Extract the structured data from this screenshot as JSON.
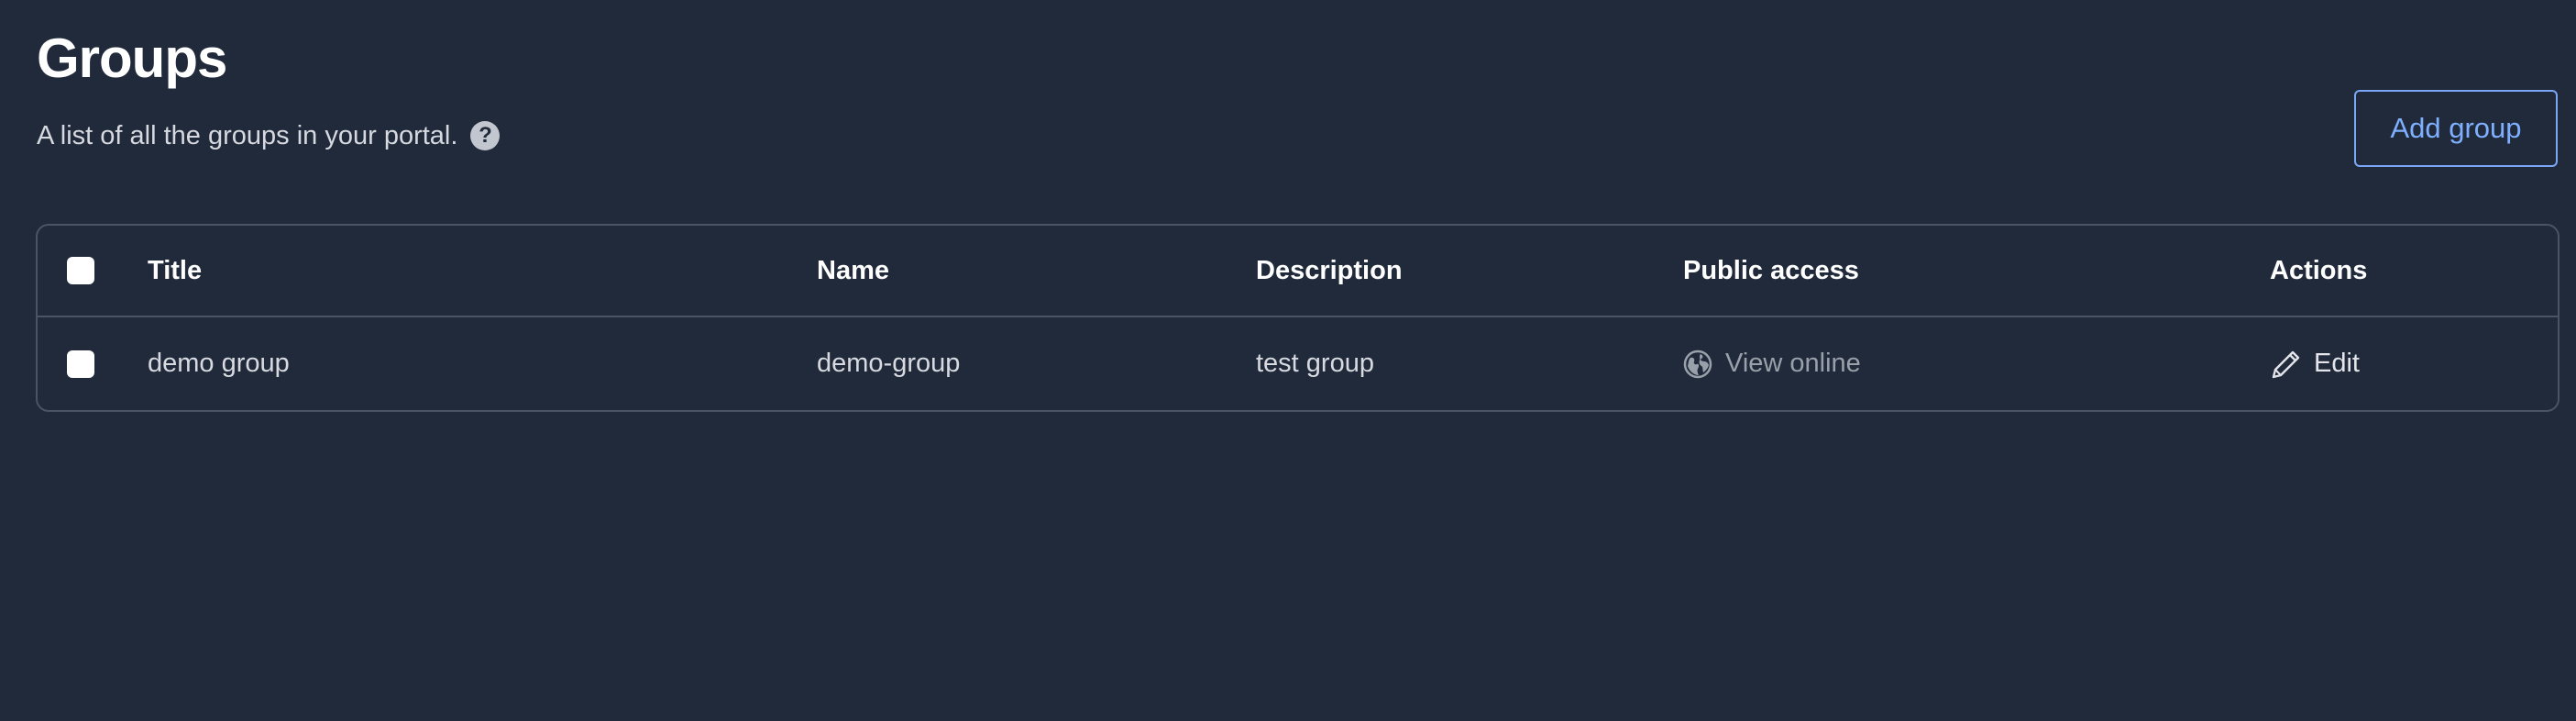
{
  "header": {
    "title": "Groups",
    "subtitle": "A list of all the groups in your portal.",
    "help_icon": "?",
    "add_button_label": "Add group"
  },
  "table": {
    "columns": [
      "Title",
      "Name",
      "Description",
      "Public access",
      "Actions"
    ],
    "rows": [
      {
        "title": "demo group",
        "name": "demo-group",
        "description": "test group",
        "public_access_label": "View online",
        "public_access_icon": "globe-icon",
        "action_label": "Edit",
        "action_icon": "pencil-icon"
      }
    ]
  },
  "colors": {
    "background": "#212a3b",
    "accent": "#7fb0ff",
    "border": "#4b5364"
  }
}
